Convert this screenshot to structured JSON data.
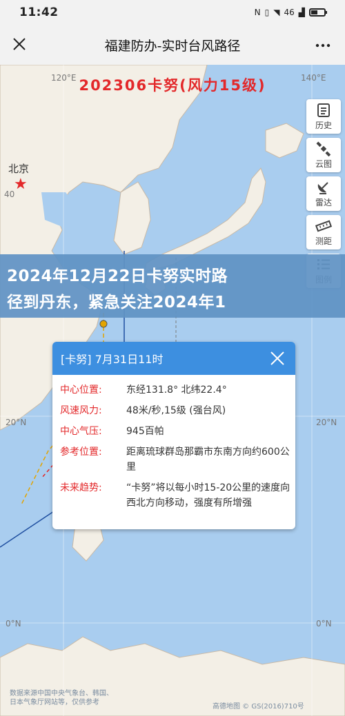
{
  "status_bar": {
    "time": "11:42",
    "signal": "46",
    "battery_icon": "battery-icon"
  },
  "title_bar": {
    "title": "福建防办-实时台风路径"
  },
  "map": {
    "typhoon_title": "202306卡努(风力15级)",
    "city": "北京",
    "city_coord": "40",
    "coords": {
      "lon_120": "120°E",
      "lon_140": "140°E",
      "lat_20_left": "20°N",
      "lat_20_right": "20°N",
      "lat_0_left": "0°N",
      "lat_0_right": "0°N"
    }
  },
  "tools": [
    {
      "label": "历史",
      "icon": "history-list-icon"
    },
    {
      "label": "云图",
      "icon": "satellite-icon"
    },
    {
      "label": "雷达",
      "icon": "radar-dish-icon"
    },
    {
      "label": "测距",
      "icon": "ruler-icon"
    },
    {
      "label": "图例",
      "icon": "legend-list-icon"
    }
  ],
  "banner": {
    "line1": "2024年12月22日卡努实时路",
    "line2": "径到丹东，紧急关注2024年1"
  },
  "popup": {
    "header": "[卡努] 7月31日11时",
    "rows": [
      {
        "key": "中心位置:",
        "value": "东经131.8°   北纬22.4°"
      },
      {
        "key": "风速风力:",
        "value": "48米/秒,15级   (强台风)"
      },
      {
        "key": "中心气压:",
        "value": "945百帕"
      },
      {
        "key": "参考位置:",
        "value": "距离琉球群岛那霸市东南方向约600公里"
      },
      {
        "key": "未来趋势:",
        "value": "“卡努”将以每小时15-20公里的速度向西北方向移动，强度有所增强"
      }
    ]
  },
  "credits": {
    "left_line1": "数据来源中国中央气象台、韩国、",
    "left_line2": "日本气象厅网站等，仅供参考",
    "right": "高德地图 © GS(2016)710号"
  }
}
